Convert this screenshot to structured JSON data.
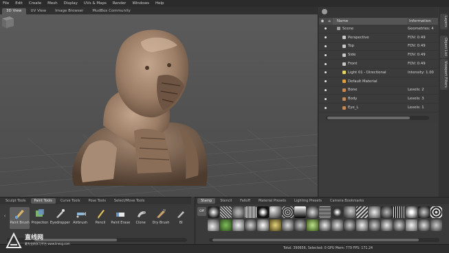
{
  "menu": [
    "File",
    "Edit",
    "Create",
    "Mesh",
    "Display",
    "UVs & Maps",
    "Render",
    "Windows",
    "Help"
  ],
  "view_tabs": [
    {
      "label": "3D View",
      "active": true
    },
    {
      "label": "UV View",
      "active": false
    },
    {
      "label": "Image Browser",
      "active": false
    },
    {
      "label": "MudBox Community",
      "active": false
    }
  ],
  "object_list": {
    "col_name": "Name",
    "col_info": "Information",
    "rows": [
      {
        "name": "Scene",
        "info": "Geometries: 4",
        "icon": "scene-icon",
        "color": "#9c9c9c",
        "indent": 1
      },
      {
        "name": "Perspective",
        "info": "FOV: 0.49",
        "icon": "camera-icon",
        "color": "#c8c8c8",
        "indent": 2
      },
      {
        "name": "Top",
        "info": "FOV: 0.49",
        "icon": "camera-icon",
        "color": "#c8c8c8",
        "indent": 2
      },
      {
        "name": "Side",
        "info": "FOV: 0.49",
        "icon": "camera-icon",
        "color": "#c8c8c8",
        "indent": 2
      },
      {
        "name": "Front",
        "info": "FOV: 0.49",
        "icon": "camera-icon",
        "color": "#c8c8c8",
        "indent": 2
      },
      {
        "name": "Light 01 - Directional",
        "info": "Intensity: 1.00",
        "icon": "light-icon",
        "color": "#e8d26a",
        "indent": 2
      },
      {
        "name": "Default Material",
        "info": "",
        "icon": "material-icon",
        "color": "#d9a441",
        "indent": 2
      },
      {
        "name": "Bone",
        "info": "Levels: 2",
        "icon": "mesh-icon",
        "color": "#c48a5a",
        "indent": 2
      },
      {
        "name": "Body",
        "info": "Levels: 3",
        "icon": "mesh-icon",
        "color": "#c48a5a",
        "indent": 2
      },
      {
        "name": "Eye_L",
        "info": "Levels: 1",
        "icon": "mesh-icon",
        "color": "#c48a5a",
        "indent": 2
      }
    ]
  },
  "side_tabs": [
    "Layers",
    "Object List",
    "Viewport Filters"
  ],
  "tool_tabs": [
    {
      "label": "Sculpt Tools",
      "active": false
    },
    {
      "label": "Paint Tools",
      "active": true
    },
    {
      "label": "Curve Tools",
      "active": false
    },
    {
      "label": "Pose Tools",
      "active": false
    },
    {
      "label": "Select/Move Tools",
      "active": false
    }
  ],
  "tools": [
    {
      "label": "Paint Brush",
      "active": true
    },
    {
      "label": "Projection",
      "active": false
    },
    {
      "label": "Eyedropper",
      "active": false
    },
    {
      "label": "Airbrush",
      "active": false
    },
    {
      "label": "Pencil",
      "active": false
    },
    {
      "label": "Paint Erase",
      "active": false
    },
    {
      "label": "Clone",
      "active": false
    },
    {
      "label": "Dry Brush",
      "active": false
    },
    {
      "label": "Bl",
      "active": false
    }
  ],
  "stamp_tabs": [
    {
      "label": "Stamp",
      "active": true
    },
    {
      "label": "Stencil",
      "active": false
    },
    {
      "label": "Falloff",
      "active": false
    },
    {
      "label": "Material Presets",
      "active": false
    },
    {
      "label": "Lighting Presets",
      "active": false
    },
    {
      "label": "Camera Bookmarks",
      "active": false
    }
  ],
  "stamp_off_label": "Off",
  "status": "Total: 390656, Selected: 0 GPU Mem: 779 FPS: 171.24",
  "watermark": {
    "main": "直线网",
    "sub": "最专业的学习平台  www.linecg.com"
  },
  "colors": {
    "accent": "#5c5c5c",
    "model": "#a68a73"
  }
}
